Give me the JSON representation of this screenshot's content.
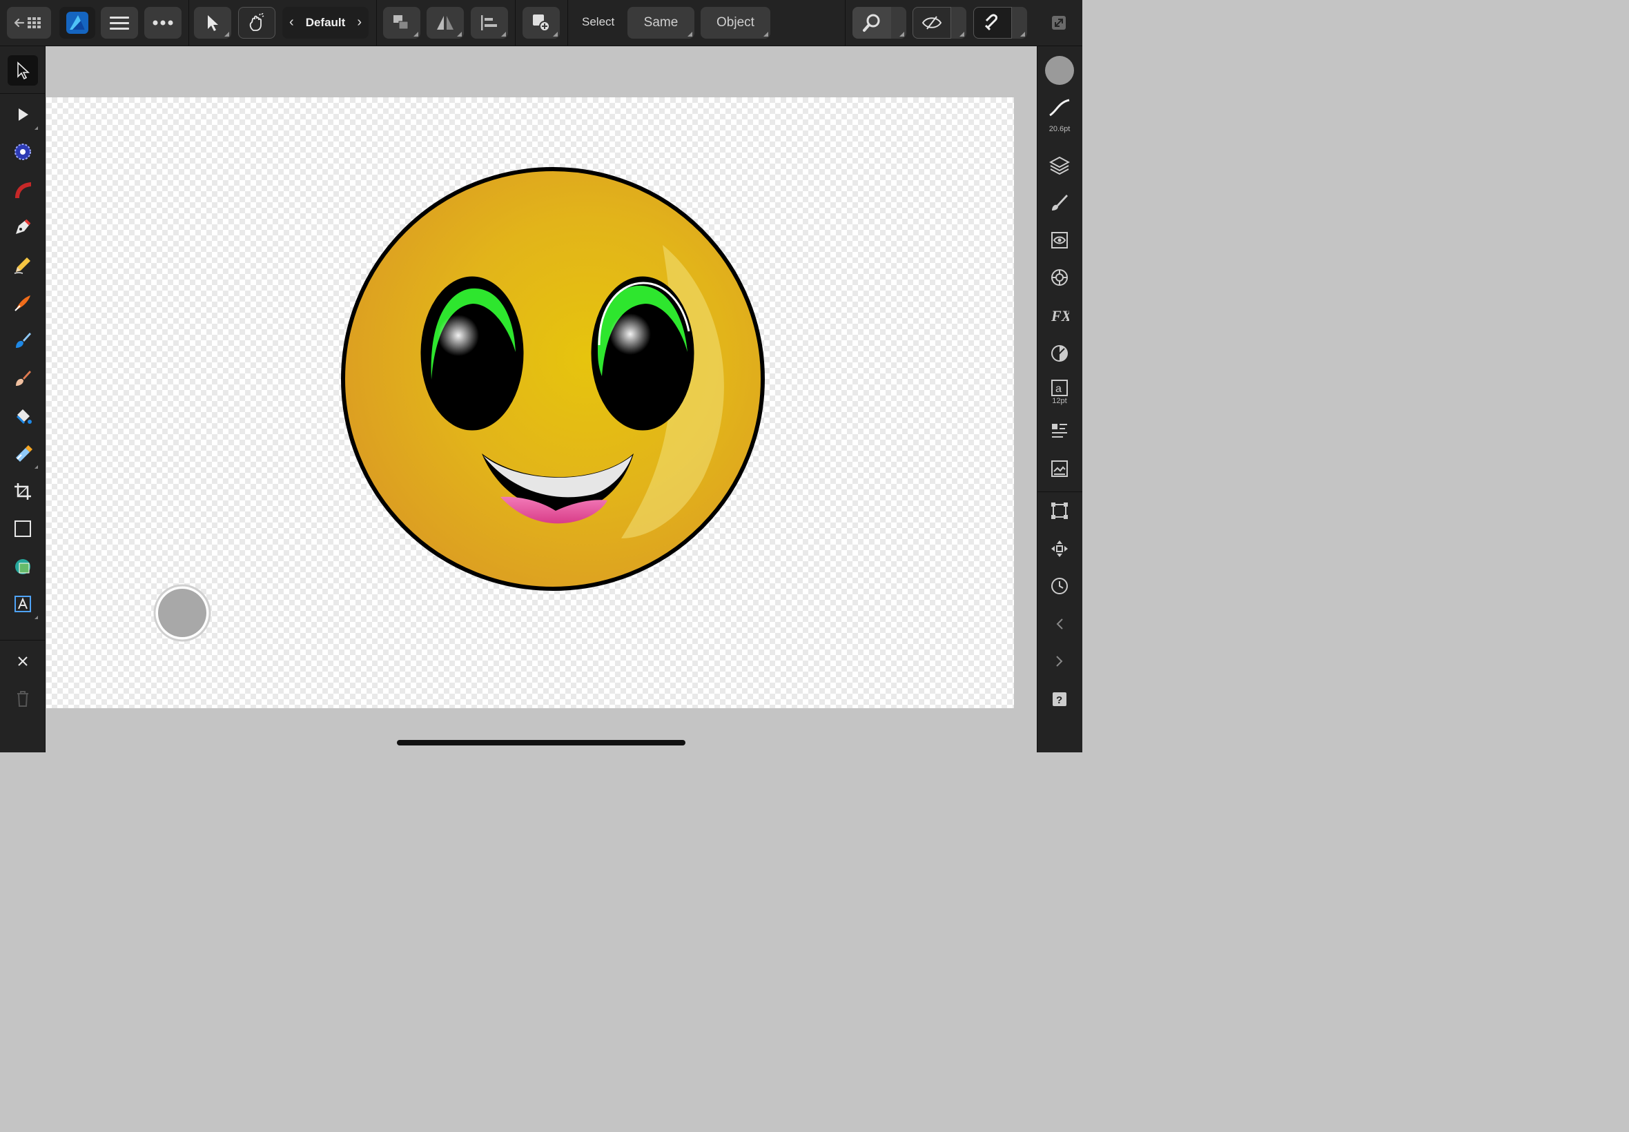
{
  "app": {
    "name": "Affinity Designer"
  },
  "toolbar": {
    "persona_label": "Default",
    "select_label": "Select",
    "same_label": "Same",
    "object_label": "Object"
  },
  "right_panel": {
    "stroke_width": "20.6pt",
    "text_size": "12pt",
    "fill_color": "#a8a8a8"
  },
  "left_tools": [
    "move-tool",
    "node-tool",
    "corner-tool",
    "pen-curve-tool",
    "pen-tool",
    "pencil-tool",
    "vector-brush-tool",
    "fill-tool",
    "paint-brush-tool",
    "smudge-tool",
    "transparency-tool",
    "crop-tool",
    "rectangle-tool",
    "shape-builder-tool",
    "artistic-text-tool"
  ],
  "colors": {
    "accent": "#1e88e5",
    "face_yellow": "#e0b318",
    "eye_green": "#2ee62e",
    "tongue_pink": "#e8539c"
  }
}
